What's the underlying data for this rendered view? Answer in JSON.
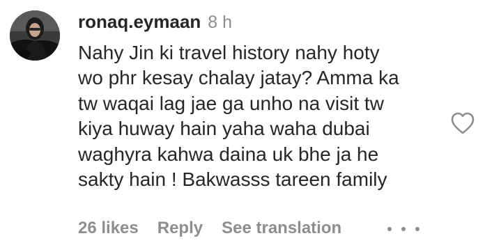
{
  "comment": {
    "username": "ronaq.eymaan",
    "timestamp": "8 h",
    "text": "Nahy Jin ki travel history nahy hoty\nwo phr kesay chalay jatay? Amma ka\ntw waqai lag jae ga unho na visit tw\nkiya huway hain yaha waha dubai\nwaghyra kahwa daina uk bhe ja he\nsakty hain ! Bakwasss tareen family",
    "likes_label": "26 likes",
    "reply_label": "Reply",
    "translate_label": "See translation",
    "icons": {
      "like": "heart-outline-icon",
      "more": "more-options-icon"
    }
  },
  "colors": {
    "primary_text": "#262626",
    "secondary_text": "#8e8e8e",
    "background": "#ffffff"
  }
}
